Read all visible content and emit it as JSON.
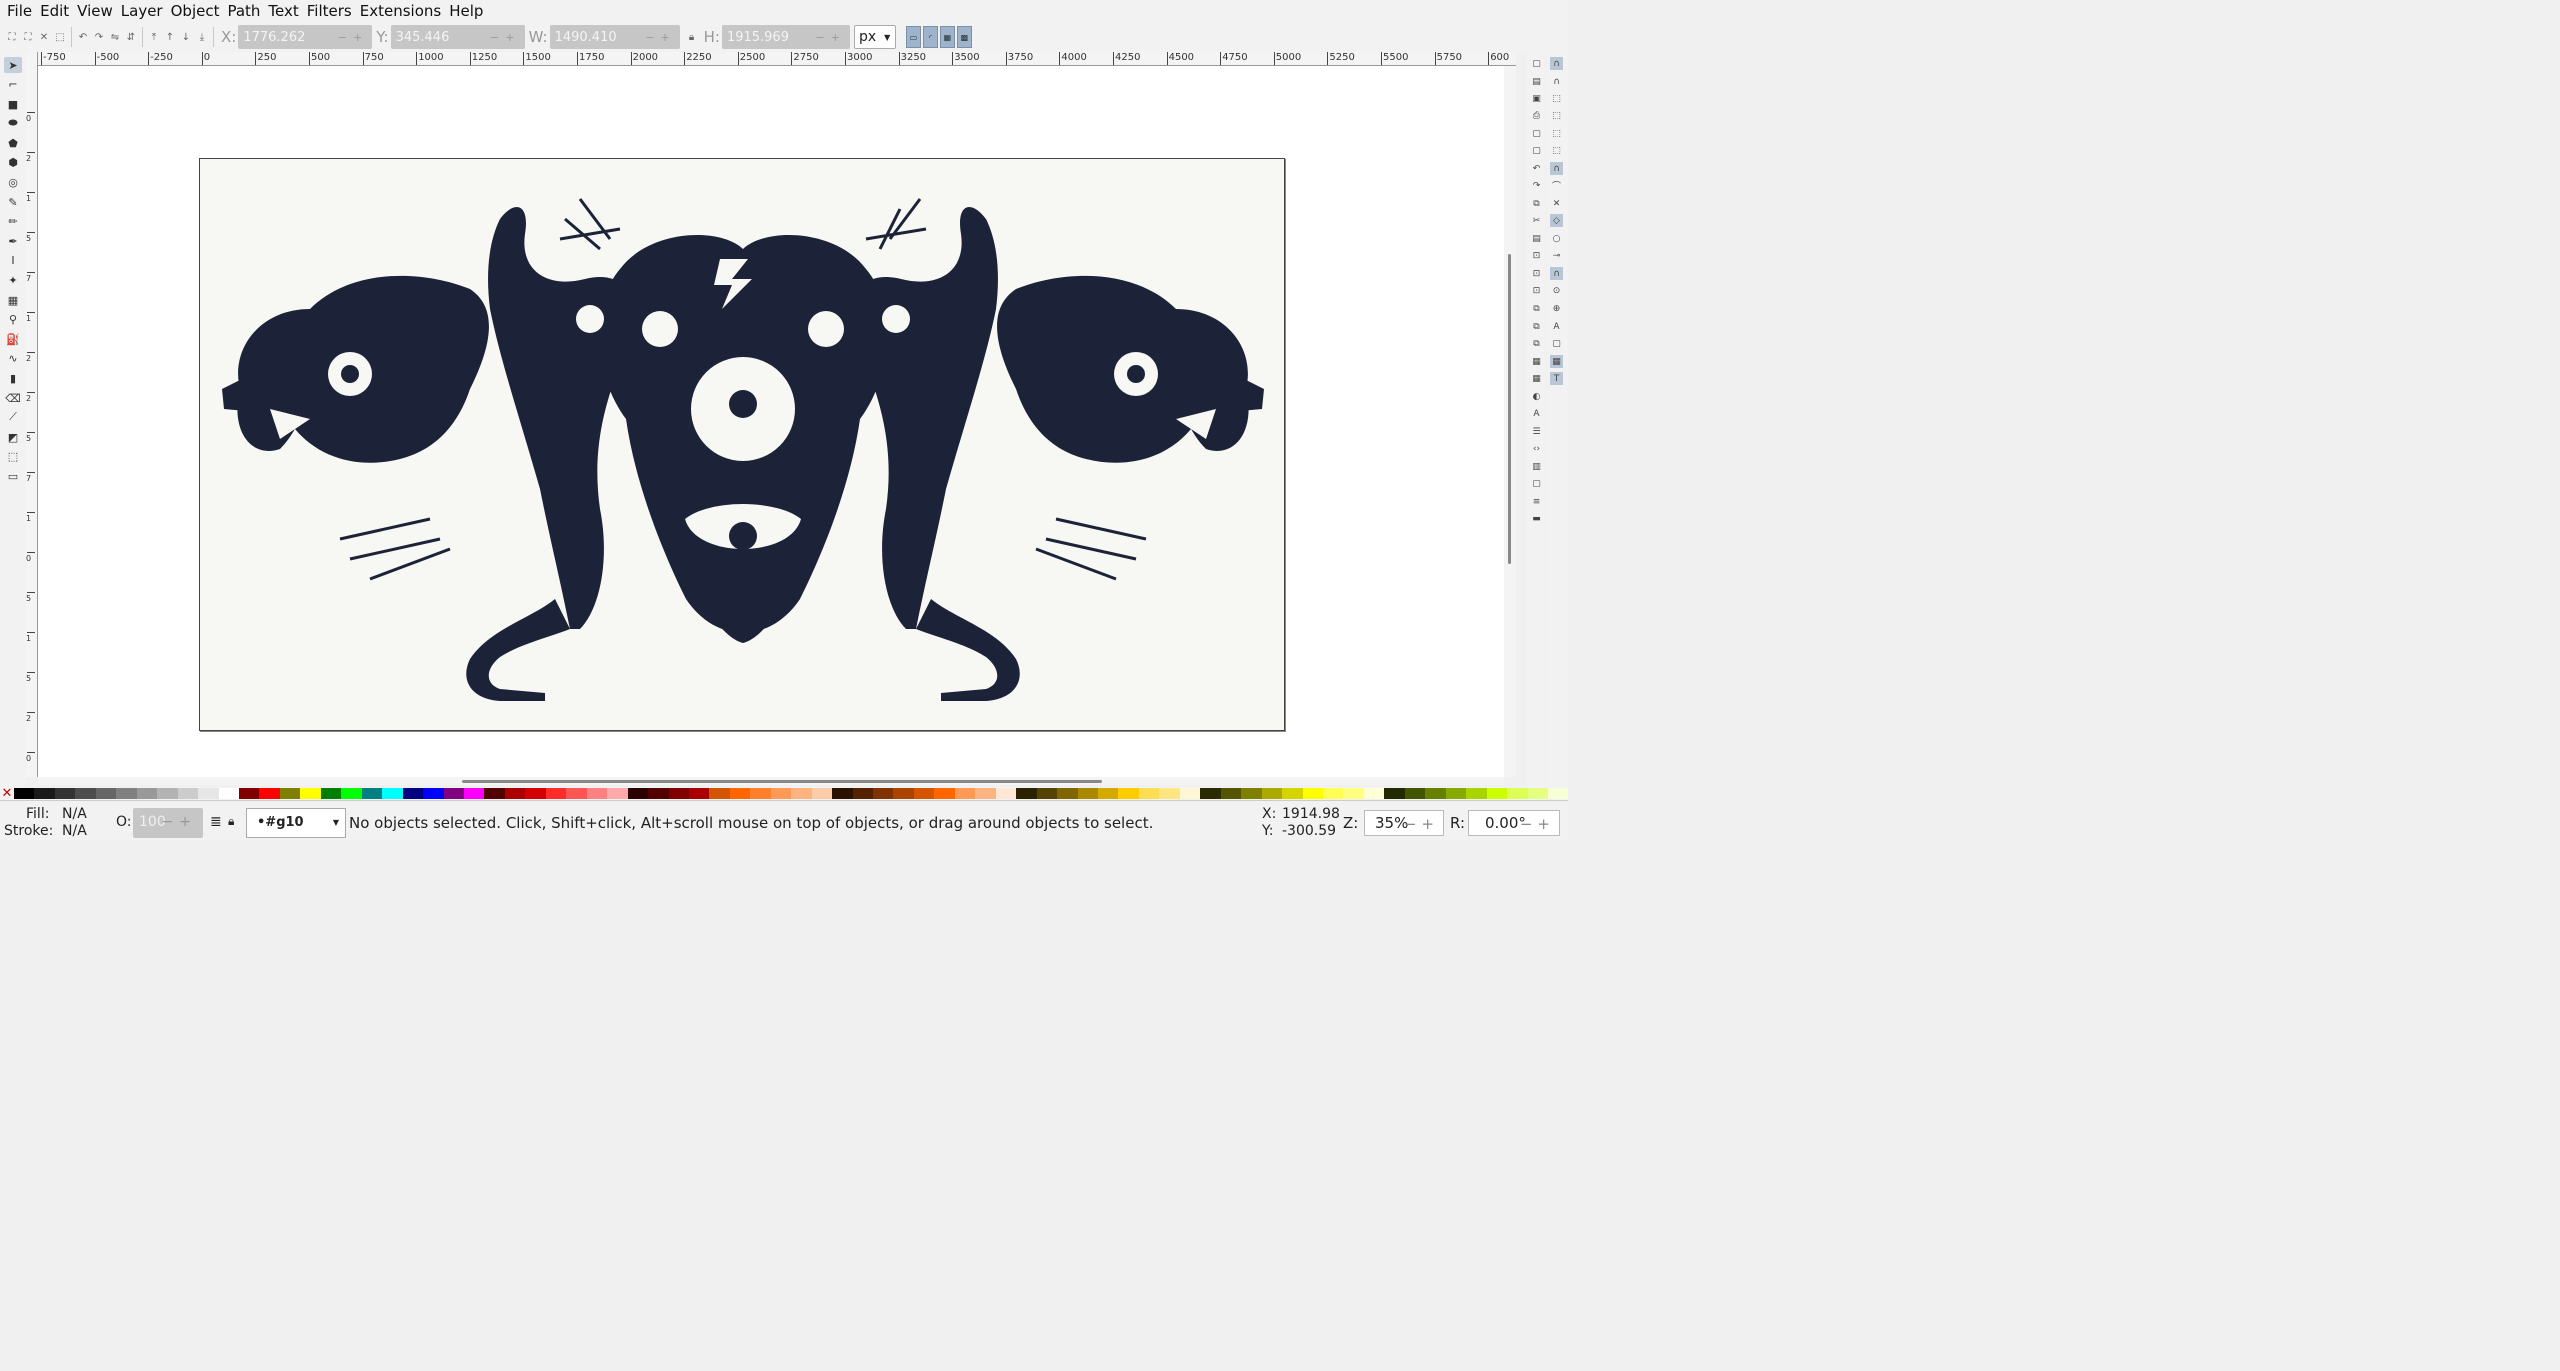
{
  "menu": [
    "File",
    "Edit",
    "View",
    "Layer",
    "Object",
    "Path",
    "Text",
    "Filters",
    "Extensions",
    "Help"
  ],
  "controls": {
    "x_label": "X:",
    "x_value": "1776.262",
    "y_label": "Y:",
    "y_value": "345.446",
    "w_label": "W:",
    "w_value": "1490.410",
    "h_label": "H:",
    "h_value": "1915.969",
    "unit": "px",
    "lock_icon": "lock-icon"
  },
  "ruler": {
    "labels": [
      "-750",
      "-500",
      "-250",
      "0",
      "250",
      "500",
      "750",
      "1000",
      "1250",
      "1500",
      "1750",
      "2000",
      "2250",
      "2500",
      "2750",
      "3000",
      "3250",
      "3500",
      "3750",
      "4000",
      "4250",
      "4500",
      "4750",
      "5000",
      "5250",
      "5500",
      "5750",
      "600"
    ],
    "vertical_labels": [
      "0",
      "2",
      "1",
      "5",
      "7",
      "1",
      "2",
      "2",
      "5",
      "7",
      "1",
      "0",
      "5",
      "1",
      "5",
      "2",
      "0"
    ]
  },
  "palette_colors": [
    "#000000",
    "#1a1a1a",
    "#333333",
    "#4d4d4d",
    "#666666",
    "#808080",
    "#999999",
    "#b3b3b3",
    "#cccccc",
    "#e6e6e6",
    "#ffffff",
    "#800000",
    "#ff0000",
    "#808000",
    "#ffff00",
    "#008000",
    "#00ff00",
    "#008080",
    "#00ffff",
    "#000080",
    "#0000ff",
    "#800080",
    "#ff00ff",
    "#550000",
    "#aa0000",
    "#d40000",
    "#ff2a2a",
    "#ff5555",
    "#ff8080",
    "#ffaaaa",
    "#2b0000",
    "#550000",
    "#800000",
    "#aa0000",
    "#d45500",
    "#ff6600",
    "#ff7f2a",
    "#ff9955",
    "#ffb380",
    "#ffccaa",
    "#2b1100",
    "#552200",
    "#803300",
    "#aa4400",
    "#d45500",
    "#ff6600",
    "#ff9955",
    "#ffb380",
    "#ffe6d5",
    "#2b2200",
    "#554400",
    "#806600",
    "#aa8800",
    "#d4aa00",
    "#ffcc00",
    "#ffdd55",
    "#ffe680",
    "#fff6d5",
    "#2b2b00",
    "#555500",
    "#808000",
    "#aaaa00",
    "#d4d400",
    "#ffff00",
    "#ffff55",
    "#ffff80",
    "#ffffd5",
    "#222b00",
    "#445500",
    "#668000",
    "#88aa00",
    "#aad400",
    "#ccff00",
    "#ddff55",
    "#e5ff80",
    "#f6ffd5"
  ],
  "status": {
    "fill_label": "Fill:",
    "fill_value": "N/A",
    "stroke_label": "Stroke:",
    "stroke_value": "N/A",
    "opacity_label": "O:",
    "opacity_value": "100",
    "layer_name": "•#g10",
    "message": "No objects selected. Click, Shift+click, Alt+scroll mouse on top of objects, or drag around objects to select.",
    "cursor_x_label": "X:",
    "cursor_x": "1914.98",
    "cursor_y_label": "Y:",
    "cursor_y": "-300.59",
    "zoom_label": "Z:",
    "zoom_value": "35%",
    "rotation_label": "R:",
    "rotation_value": "0.00°"
  },
  "colors": {
    "ink": "#1c2339",
    "page": "#f7f7f3",
    "accent": "#9eb3cc"
  }
}
